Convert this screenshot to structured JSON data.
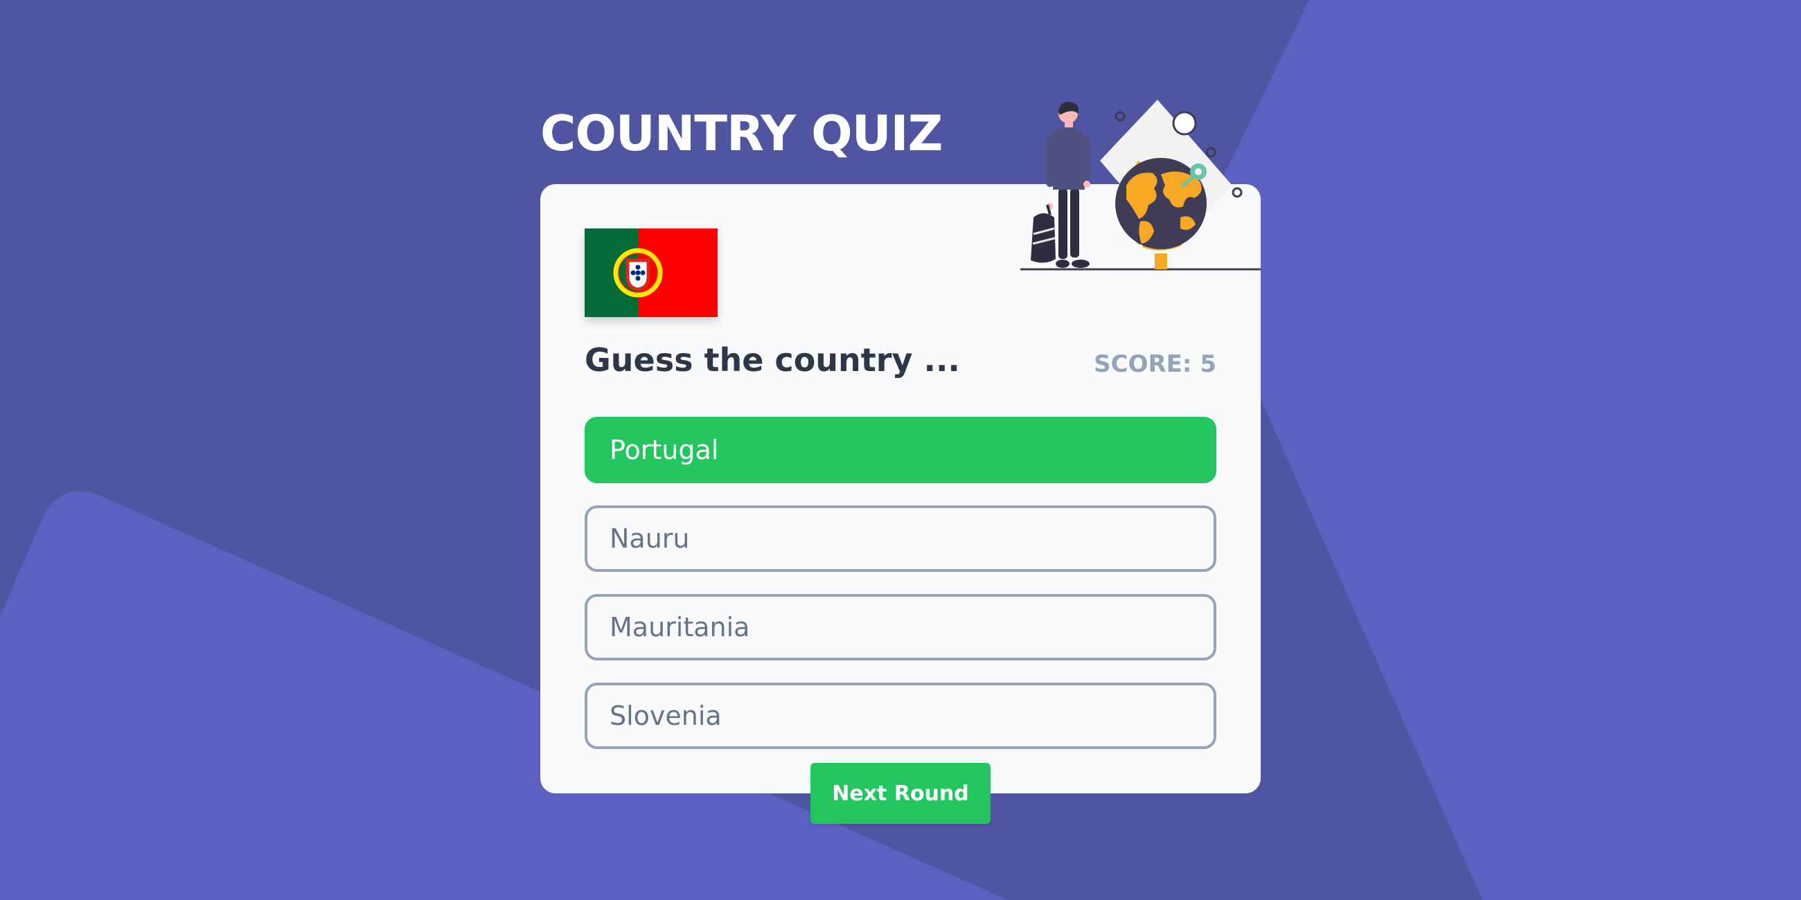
{
  "app": {
    "title": "COUNTRY QUIZ"
  },
  "quiz": {
    "question": "Guess the country ...",
    "score_text": "SCORE: 5",
    "flag_icon": "portugal-flag-icon",
    "illustration": "traveler-with-globe-illustration",
    "options": [
      {
        "label": "Portugal",
        "state": "correct"
      },
      {
        "label": "Nauru",
        "state": "default"
      },
      {
        "label": "Mauritania",
        "state": "default"
      },
      {
        "label": "Slovenia",
        "state": "default"
      }
    ],
    "next_label": "Next Round"
  },
  "colors": {
    "background_dark": "#4f55a0",
    "background_light": "#5c61c1",
    "card_background": "#f8fafc",
    "correct_green": "#22c55e",
    "option_border": "#94a3b8",
    "question_text": "#2d3748",
    "score_text": "#94a3b8"
  }
}
